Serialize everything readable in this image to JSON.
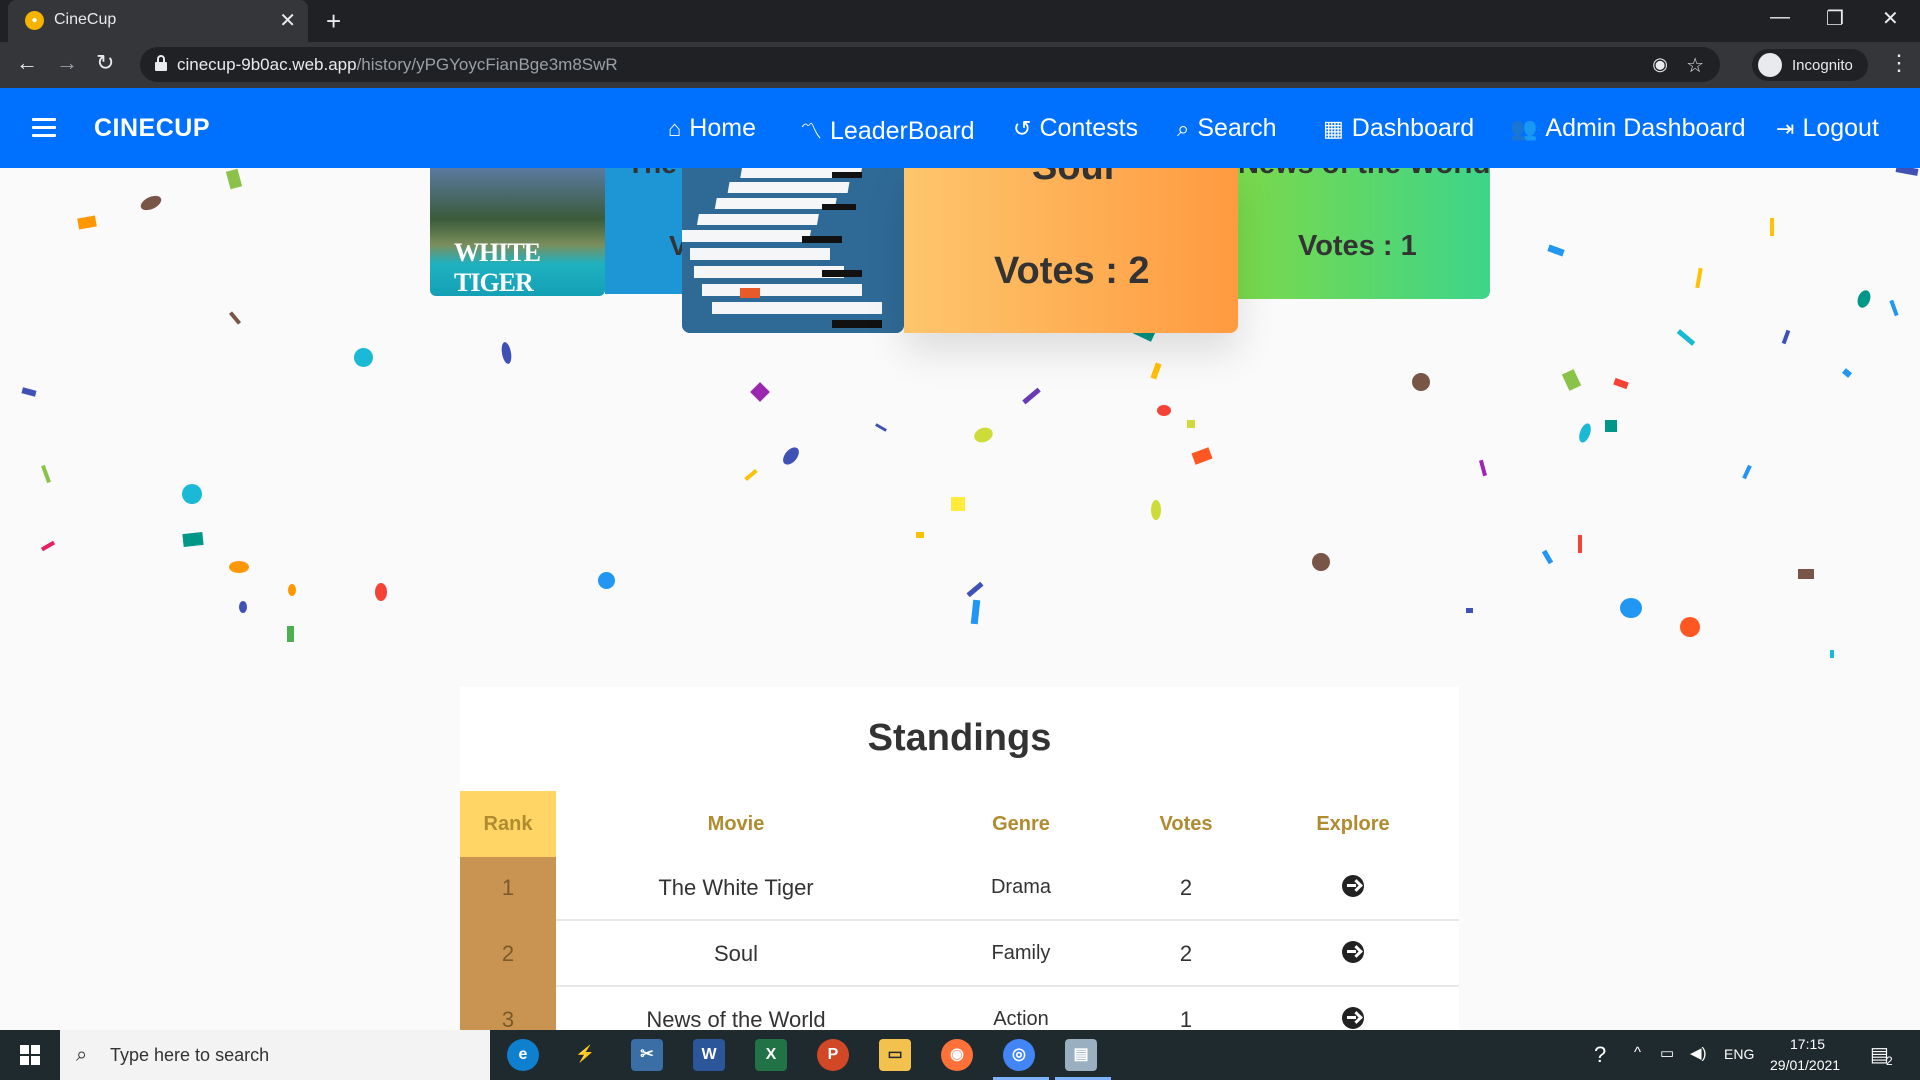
{
  "browser": {
    "tab_title": "CineCup",
    "url_host": "cinecup-9b0ac.web.app",
    "url_path": "/history/yPGYoycFianBge3m8SwR",
    "profile_label": "Incognito"
  },
  "app": {
    "brand": "CINECUP",
    "nav": [
      {
        "label": "Home",
        "icon": "home-icon"
      },
      {
        "label": "LeaderBoard",
        "icon": "trending-icon"
      },
      {
        "label": "Contests",
        "icon": "history-icon"
      },
      {
        "label": "Search",
        "icon": "search-icon"
      },
      {
        "label": "Dashboard",
        "icon": "dashboard-icon"
      },
      {
        "label": "Admin Dashboard",
        "icon": "group-icon"
      },
      {
        "label": "Logout",
        "icon": "logout-icon"
      }
    ],
    "colors": {
      "navbar": "#0070ff",
      "soul_card": "#ff9a40",
      "news_card": "#3dd58a"
    }
  },
  "hero": {
    "left_card": {
      "poster_text": "WHITE TIGER",
      "partial_title": "The",
      "partial_votes": "V"
    },
    "center_card": {
      "partial_title": "Soul",
      "votes": "Votes : 2"
    },
    "right_card": {
      "partial_title": "News of the World",
      "votes": "Votes : 1"
    }
  },
  "standings": {
    "title": "Standings",
    "headers": {
      "rank": "Rank",
      "movie": "Movie",
      "genre": "Genre",
      "votes": "Votes",
      "explore": "Explore"
    },
    "rows": [
      {
        "rank": "1",
        "movie": "The White Tiger",
        "genre": "Drama",
        "votes": "2"
      },
      {
        "rank": "2",
        "movie": "Soul",
        "genre": "Family",
        "votes": "2"
      },
      {
        "rank": "3",
        "movie": "News of the World",
        "genre": "Action",
        "votes": "1"
      }
    ]
  },
  "taskbar": {
    "search_placeholder": "Type here to search",
    "language": "ENG",
    "time": "17:15",
    "date": "29/01/2021",
    "notification_count": "2"
  }
}
